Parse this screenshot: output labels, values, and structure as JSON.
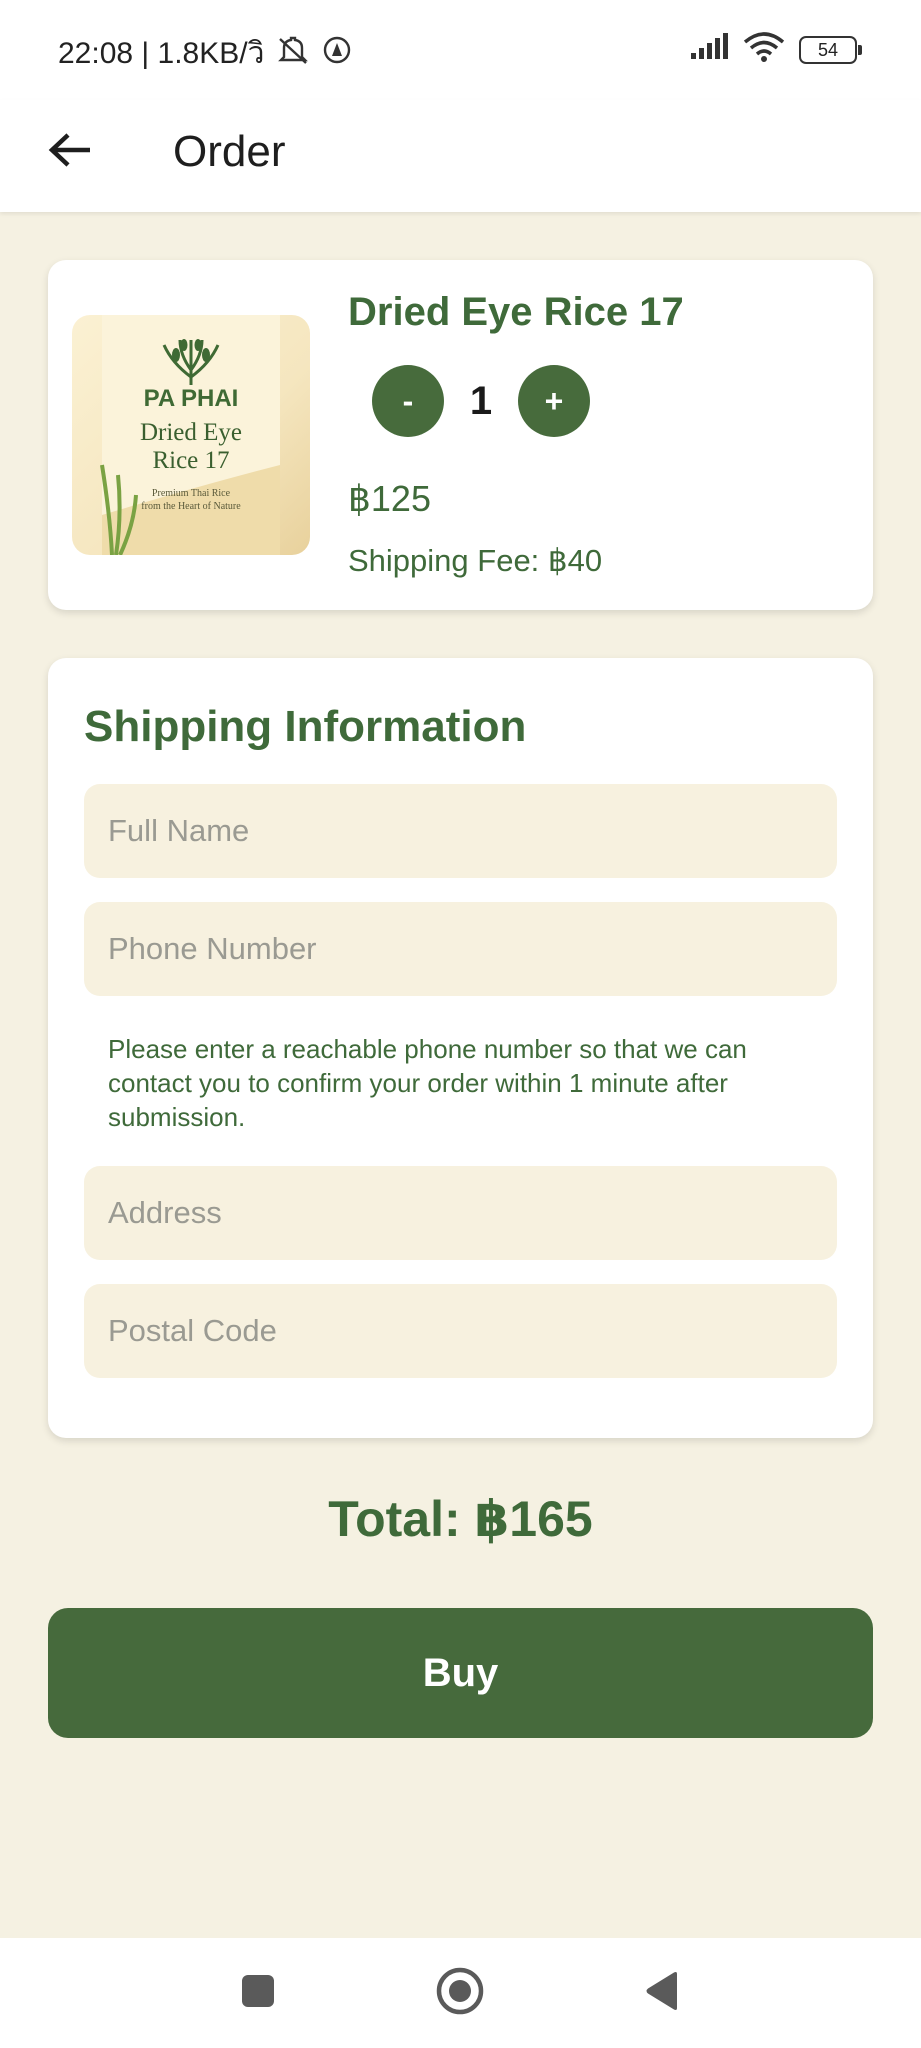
{
  "status_bar": {
    "time_text": "22:08 | 1.8KB/วิ",
    "battery": "54"
  },
  "app_bar": {
    "title": "Order"
  },
  "product": {
    "name": "Dried Eye Rice 17",
    "quantity": "1",
    "decrement_label": "-",
    "increment_label": "+",
    "price": "฿125",
    "shipping_fee": "Shipping Fee: ฿40",
    "image": {
      "brand": "PA PHAI",
      "name_line1": "Dried Eye",
      "name_line2": "Rice 17",
      "tagline_line1": "Premium Thai Rice",
      "tagline_line2": "from the Heart of Nature"
    }
  },
  "shipping": {
    "title": "Shipping Information",
    "full_name_placeholder": "Full Name",
    "phone_placeholder": "Phone Number",
    "phone_hint": "Please enter a reachable phone number so that we can contact you to confirm your order within 1 minute after submission.",
    "address_placeholder": "Address",
    "postal_code_placeholder": "Postal Code"
  },
  "total": "Total: ฿165",
  "buy_label": "Buy",
  "colors": {
    "primary_green": "#466a3c",
    "background_cream": "#f5f1e2",
    "field_fill": "#f7f1df"
  },
  "icons": {
    "back": "arrow-left-icon",
    "nav_recents": "square-icon",
    "nav_home": "circle-icon",
    "nav_back": "triangle-back-icon"
  }
}
